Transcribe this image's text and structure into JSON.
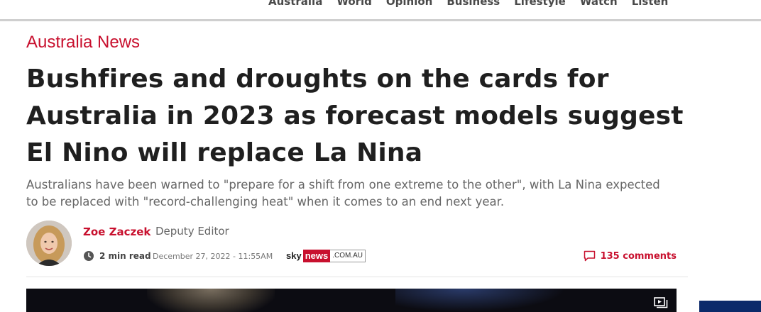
{
  "nav": {
    "items": [
      "Australia",
      "World",
      "Opinion",
      "Business",
      "Lifestyle",
      "Watch",
      "Listen"
    ]
  },
  "article": {
    "section": "Australia News",
    "headline": "Bushfires and droughts on the cards for Australia in 2023 as forecast models suggest El Nino will replace La Nina",
    "standfirst": "Australians have been warned to \"prepare for a shift from one extreme to the other\", with La Nina expected to be replaced with \"record-challenging heat\" when it comes to an end next year."
  },
  "byline": {
    "author": "Zoe Zaczek",
    "role": "Deputy Editor",
    "read_time": "2 min read",
    "date": "December 27, 2022 - 11:55AM",
    "publisher": {
      "sky": "sky",
      "news": "news",
      "domain": ".COM.AU"
    },
    "comments": "135 comments"
  },
  "colors": {
    "accent": "#c8102e",
    "text": "#1f1f1f",
    "muted": "#666666"
  },
  "icons": {
    "clock": "clock-icon",
    "comment": "comment-icon",
    "video_control": "video-playlist-icon"
  }
}
